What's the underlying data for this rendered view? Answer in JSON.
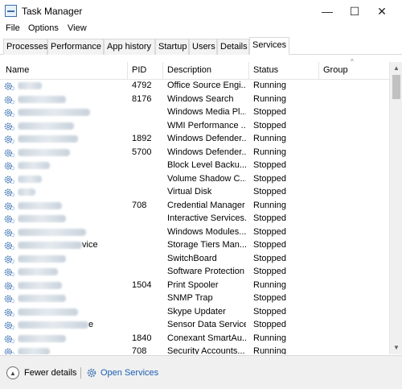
{
  "window": {
    "title": "Task Manager",
    "controls": [
      "—",
      "☐",
      "✕"
    ]
  },
  "menu": [
    "File",
    "Options",
    "View"
  ],
  "tabs": [
    {
      "label": "Processes",
      "active": false
    },
    {
      "label": "Performance",
      "active": false
    },
    {
      "label": "App history",
      "active": false
    },
    {
      "label": "Startup",
      "active": false
    },
    {
      "label": "Users",
      "active": false
    },
    {
      "label": "Details",
      "active": false
    },
    {
      "label": "Services",
      "active": true
    }
  ],
  "columns": {
    "name": "Name",
    "pid": "PID",
    "description": "Description",
    "status": "Status",
    "group": "Group"
  },
  "services": [
    {
      "name": "",
      "pid": "4792",
      "description": "Office  Source Engi...",
      "status": "Running",
      "group": ""
    },
    {
      "name": "",
      "pid": "8176",
      "description": "Windows Search",
      "status": "Running",
      "group": ""
    },
    {
      "name": "",
      "pid": "",
      "description": "Windows Media Pl...",
      "status": "Stopped",
      "group": ""
    },
    {
      "name": "",
      "pid": "",
      "description": "WMI Performance ...",
      "status": "Stopped",
      "group": ""
    },
    {
      "name": "",
      "pid": "1892",
      "description": "Windows Defender...",
      "status": "Running",
      "group": ""
    },
    {
      "name": "",
      "pid": "5700",
      "description": "Windows Defender...",
      "status": "Running",
      "group": ""
    },
    {
      "name": "",
      "pid": "",
      "description": "Block Level Backu...",
      "status": "Stopped",
      "group": ""
    },
    {
      "name": "",
      "pid": "",
      "description": "Volume Shadow C...",
      "status": "Stopped",
      "group": ""
    },
    {
      "name": "",
      "pid": "",
      "description": "Virtual Disk",
      "status": "Stopped",
      "group": ""
    },
    {
      "name": "",
      "pid": "708",
      "description": "Credential Manager",
      "status": "Running",
      "group": ""
    },
    {
      "name": "",
      "pid": "",
      "description": "Interactive Services...",
      "status": "Stopped",
      "group": ""
    },
    {
      "name": "",
      "pid": "",
      "description": "Windows Modules...",
      "status": "Stopped",
      "group": ""
    },
    {
      "name": "vice",
      "pid": "",
      "description": "Storage Tiers Man...",
      "status": "Stopped",
      "group": ""
    },
    {
      "name": "",
      "pid": "",
      "description": "SwitchBoard",
      "status": "Stopped",
      "group": ""
    },
    {
      "name": "",
      "pid": "",
      "description": "Software Protection",
      "status": "Stopped",
      "group": ""
    },
    {
      "name": "",
      "pid": "1504",
      "description": "Print Spooler",
      "status": "Running",
      "group": ""
    },
    {
      "name": "",
      "pid": "",
      "description": "SNMP Trap",
      "status": "Stopped",
      "group": ""
    },
    {
      "name": "",
      "pid": "",
      "description": "Skype Updater",
      "status": "Stopped",
      "group": ""
    },
    {
      "name": "e",
      "pid": "",
      "description": "Sensor Data Service",
      "status": "Stopped",
      "group": ""
    },
    {
      "name": "",
      "pid": "1840",
      "description": "Conexant SmartAu...",
      "status": "Running",
      "group": ""
    },
    {
      "name": "",
      "pid": "708",
      "description": "Security Accounts...",
      "status": "Running",
      "group": ""
    }
  ],
  "footer": {
    "fewer_details": "Fewer details",
    "open_services": "Open Services"
  },
  "colors": {
    "link": "#1a5fb4",
    "gear": "#3a70b0"
  }
}
